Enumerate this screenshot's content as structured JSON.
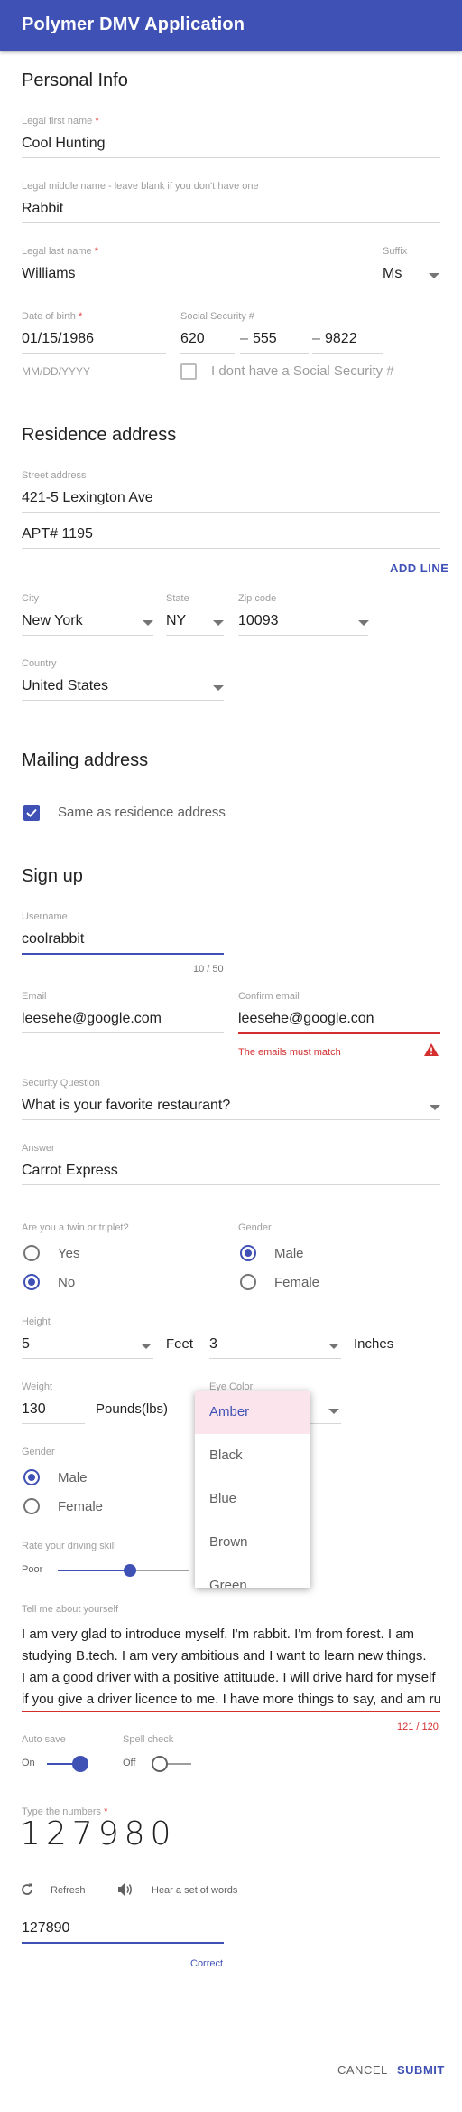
{
  "app": {
    "title": "Polymer DMV Application"
  },
  "personal": {
    "heading": "Personal Info",
    "first_label": "Legal first name",
    "first_value": "Cool Hunting",
    "middle_label": "Legal middle name - leave blank if you don't have one",
    "middle_value": "Rabbit",
    "last_label": "Legal last name",
    "last_value": "Williams",
    "suffix_label": "Suffix",
    "suffix_value": "Ms",
    "dob_label": "Date of birth",
    "dob_value": "01/15/1986",
    "dob_hint": "MM/DD/YYYY",
    "ssn_label": "Social Security #",
    "ssn_1": "620",
    "ssn_2": "555",
    "ssn_3": "9822",
    "ssn_sep": "–",
    "no_ssn_label": "I dont have a Social Security #"
  },
  "residence": {
    "heading": "Residence address",
    "street_label": "Street address",
    "street_1": "421-5 Lexington Ave",
    "street_2": "APT# 1195",
    "add_line": "ADD LINE",
    "city_label": "City",
    "city_value": "New York",
    "state_label": "State",
    "state_value": "NY",
    "zip_label": "Zip code",
    "zip_value": "10093",
    "country_label": "Country",
    "country_value": "United States"
  },
  "mailing": {
    "heading": "Mailing address",
    "same_label": "Same as residence address"
  },
  "signup": {
    "heading": "Sign up",
    "username_label": "Username",
    "username_value": "coolrabbit",
    "username_count": "10 / 50",
    "email_label": "Email",
    "email_value": "leesehe@google.com",
    "confirm_label": "Confirm email",
    "confirm_value": "leesehe@google.con",
    "confirm_error": "The emails must match",
    "question_label": "Security Question",
    "question_value": "What is your favorite restaurant?",
    "answer_label": "Answer",
    "answer_value": "Carrot Express",
    "twin_label": "Are you a twin or triplet?",
    "twin_yes": "Yes",
    "twin_no": "No",
    "gender_label": "Gender",
    "gender_male": "Male",
    "gender_female": "Female",
    "height_label": "Height",
    "height_feet_value": "5",
    "height_feet_unit": "Feet",
    "height_inches_value": "3",
    "height_inches_unit": "Inches",
    "weight_label": "Weight",
    "weight_value": "130",
    "weight_unit": "Pounds(lbs)",
    "eye_label": "Eye Color",
    "eye_options": [
      "Amber",
      "Black",
      "Blue",
      "Brown",
      "Green"
    ],
    "gender2_label": "Gender",
    "gender2_male": "Male",
    "gender2_female": "Female",
    "skill_label": "Rate your driving skill",
    "skill_min": "Poor",
    "skill_level": 0.55,
    "about_label": "Tell me about yourself",
    "about_lines": [
      "I am very glad to introduce myself. I'm rabbit. I'm from forest. I am",
      "studying B.tech. I am very ambitious and I want to learn new things.",
      "I am a good driver with a positive attituude. I will drive hard for myself",
      "if you give a driver licence to me. I have more things to say, and am ru"
    ],
    "about_count": "121 / 120",
    "autosave_label": "Auto save",
    "autosave_state": "On",
    "spell_label": "Spell check",
    "spell_state": "Off",
    "captcha_label": "Type the numbers",
    "captcha_text": "127980",
    "refresh_label": "Refresh",
    "audio_label": "Hear a set of words",
    "captcha_value": "127890",
    "captcha_status": "Correct"
  },
  "actions": {
    "cancel": "CANCEL",
    "submit": "SUBMIT"
  },
  "colors": {
    "primary": "#3f51b5",
    "error": "#d32f2f",
    "selected_bg": "#fce4ec"
  }
}
